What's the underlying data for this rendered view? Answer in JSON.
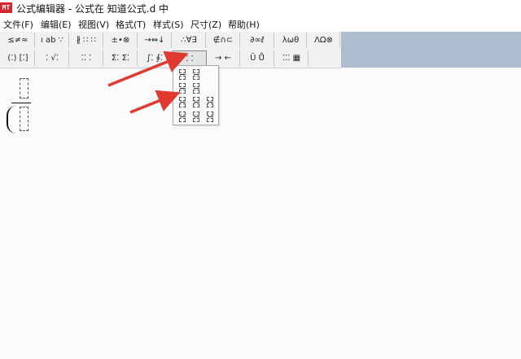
{
  "window": {
    "app_icon_text": "MT",
    "title": "公式编辑器 - 公式在 知道公式.d 中"
  },
  "menu": {
    "items": [
      {
        "label": "文件(F)"
      },
      {
        "label": "编辑(E)"
      },
      {
        "label": "视图(V)"
      },
      {
        "label": "格式(T)"
      },
      {
        "label": "样式(S)"
      },
      {
        "label": "尺寸(Z)"
      },
      {
        "label": "帮助(H)"
      }
    ]
  },
  "toolbar": {
    "row1": [
      {
        "label": "≤≠≈"
      },
      {
        "label": "ı ab ∵"
      },
      {
        "label": "∦ ∷ ∷"
      },
      {
        "label": "±•⊗"
      },
      {
        "label": "→⇔↓"
      },
      {
        "label": "∴∀∃"
      },
      {
        "label": "∉∩⊂"
      },
      {
        "label": "∂∞ℓ"
      },
      {
        "label": "λωθ"
      },
      {
        "label": "ΛΩ⊗"
      }
    ],
    "row2": [
      {
        "label": "(⁚) [⁚]"
      },
      {
        "label": "⁚ √⁚"
      },
      {
        "label": "⁚⁚ ⁚"
      },
      {
        "label": "Σ⁚ Σ⁚"
      },
      {
        "label": "∫⁚ ∮⁚"
      },
      {
        "label": "⁚ ⁚"
      },
      {
        "label": "→ ←"
      },
      {
        "label": "Ū Ů"
      },
      {
        "label": "⁚⁚⁚ ▦"
      }
    ]
  },
  "dropdown": {
    "rows": [
      [
        "⁚",
        "⁚"
      ],
      [
        "⁚",
        "⁚"
      ],
      [
        "⁚",
        "⁚",
        "⁚"
      ],
      [
        "⁚",
        "⁚",
        "⁚"
      ]
    ]
  },
  "colors": {
    "annotation_arrow": "#e03a2f",
    "toolbar_blue": "#aebcd1"
  }
}
